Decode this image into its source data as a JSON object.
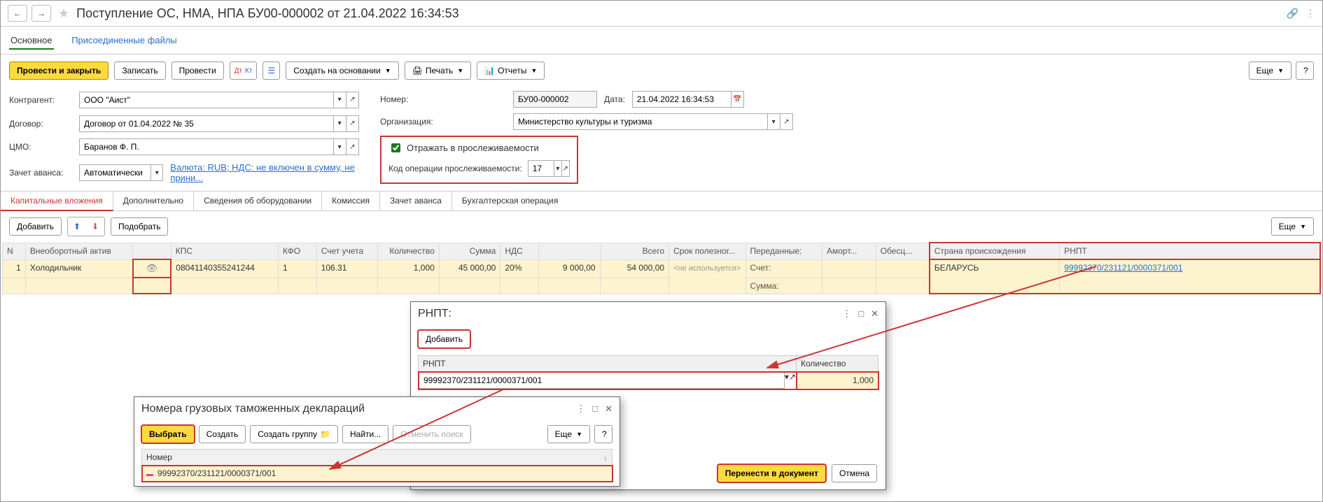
{
  "title": "Поступление ОС, НМА, НПА БУ00-000002 от 21.04.2022 16:34:53",
  "section_tabs": {
    "main": "Основное",
    "files": "Присоединенные файлы"
  },
  "toolbar": {
    "post_close": "Провести и закрыть",
    "save": "Записать",
    "post": "Провести",
    "create_based": "Создать на основании",
    "print": "Печать",
    "reports": "Отчеты",
    "more": "Еще"
  },
  "form": {
    "counterparty_label": "Контрагент:",
    "counterparty": "ООО \"Аист\"",
    "contract_label": "Договор:",
    "contract": "Договор от 01.04.2022 № 35",
    "cmo_label": "ЦМО:",
    "cmo": "Баранов Ф. П.",
    "advance_label": "Зачет аванса:",
    "advance": "Автоматически",
    "currency_link": "Валюта: RUB; НДС: не включен в сумму, не прини...",
    "number_label": "Номер:",
    "number": "БУ00-000002",
    "date_label": "Дата:",
    "date": "21.04.2022 16:34:53",
    "org_label": "Организация:",
    "org": "Министерство культуры и туризма",
    "tracking_check": "Отражать в прослеживаемости",
    "tracking_code_label": "Код операции прослеживаемости:",
    "tracking_code": "17"
  },
  "tabs": [
    "Капитальные вложения",
    "Дополнительно",
    "Сведения об оборудовании",
    "Комиссия",
    "Зачет аванса",
    "Бухгалтерская операция"
  ],
  "table_toolbar": {
    "add": "Добавить",
    "pick": "Подобрать",
    "more": "Еще"
  },
  "columns": {
    "n": "N",
    "asset": "Внеоборотный актив",
    "eye": "",
    "kps": "КПС",
    "kfo": "КФО",
    "acct": "Счет учета",
    "qty": "Количество",
    "sum": "Сумма",
    "vat": "НДС",
    "vat_sum": "",
    "total": "Всего",
    "life": "Срок полезног...",
    "transferred": "Переданные:",
    "amort": "Аморт...",
    "obesc": "Обесц...",
    "country": "Страна происхождения",
    "rnpt": "РНПТ"
  },
  "row": {
    "n": "1",
    "asset": "Холодильник",
    "kps": "08041140355241244",
    "kfo": "1",
    "acct": "106.31",
    "qty": "1,000",
    "sum": "45 000,00",
    "vat": "20%",
    "vat_sum": "9 000,00",
    "total": "54 000,00",
    "life": "<не используется>",
    "t_acct_label": "Счет:",
    "t_sum_label": "Сумма:",
    "country": "БЕЛАРУСЬ",
    "rnpt": "99992370/231121/0000371/001"
  },
  "rnpt_popup": {
    "title": "РНПТ:",
    "add": "Добавить",
    "col_rnpt": "РНПТ",
    "col_qty": "Количество",
    "value": "99992370/231121/0000371/001",
    "qty": "1,000",
    "transfer": "Перенести в документ",
    "cancel": "Отмена"
  },
  "gtd_popup": {
    "title": "Номера грузовых таможенных деклараций",
    "select": "Выбрать",
    "create": "Создать",
    "create_group": "Создать группу",
    "find": "Найти...",
    "cancel_find": "Отменить поиск",
    "more": "Еще",
    "col_number": "Номер",
    "row": "99992370/231121/0000371/001"
  }
}
